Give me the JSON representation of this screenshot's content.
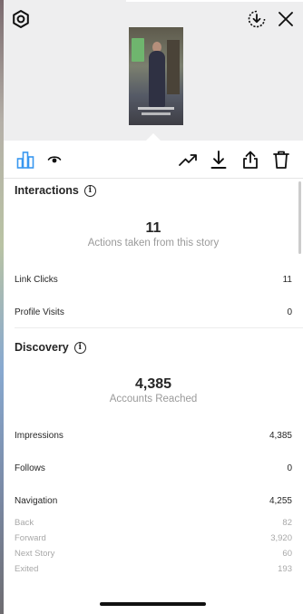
{
  "toolbar_icons": {
    "top": [
      "settings-icon",
      "download-circle-icon",
      "close-icon"
    ],
    "actions": [
      "bar-chart-icon",
      "eye-icon",
      "trending-icon",
      "download-icon",
      "share-icon",
      "trash-icon"
    ],
    "accent": "#3897f0"
  },
  "interactions": {
    "title": "Interactions",
    "total": "11",
    "total_caption": "Actions taken from this story",
    "rows": [
      {
        "label": "Link Clicks",
        "value": "11"
      },
      {
        "label": "Profile Visits",
        "value": "0"
      }
    ]
  },
  "discovery": {
    "title": "Discovery",
    "total": "4,385",
    "total_caption": "Accounts Reached",
    "rows": [
      {
        "label": "Impressions",
        "value": "4,385"
      },
      {
        "label": "Follows",
        "value": "0"
      },
      {
        "label": "Navigation",
        "value": "4,255"
      }
    ],
    "navigation": [
      {
        "label": "Back",
        "value": "82"
      },
      {
        "label": "Forward",
        "value": "3,920"
      },
      {
        "label": "Next Story",
        "value": "60"
      },
      {
        "label": "Exited",
        "value": "193"
      }
    ]
  }
}
